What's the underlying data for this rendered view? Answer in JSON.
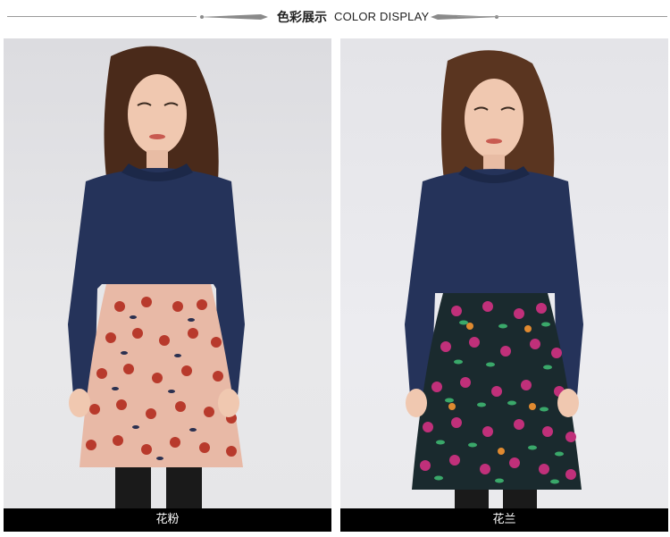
{
  "header": {
    "title_cn": "色彩展示",
    "title_en": "COLOR DISPLAY"
  },
  "panels": [
    {
      "caption": "花粉",
      "skirt_color": "#e8b9a6",
      "print_color": "#b83a2c"
    },
    {
      "caption": "花兰",
      "skirt_color": "#1a2a2e",
      "print_color": "#c0307a"
    }
  ],
  "colors": {
    "top": "#25335a",
    "hair": "#4a2a1a",
    "skin": "#f0c8b0",
    "caption_bar": "#000000"
  }
}
